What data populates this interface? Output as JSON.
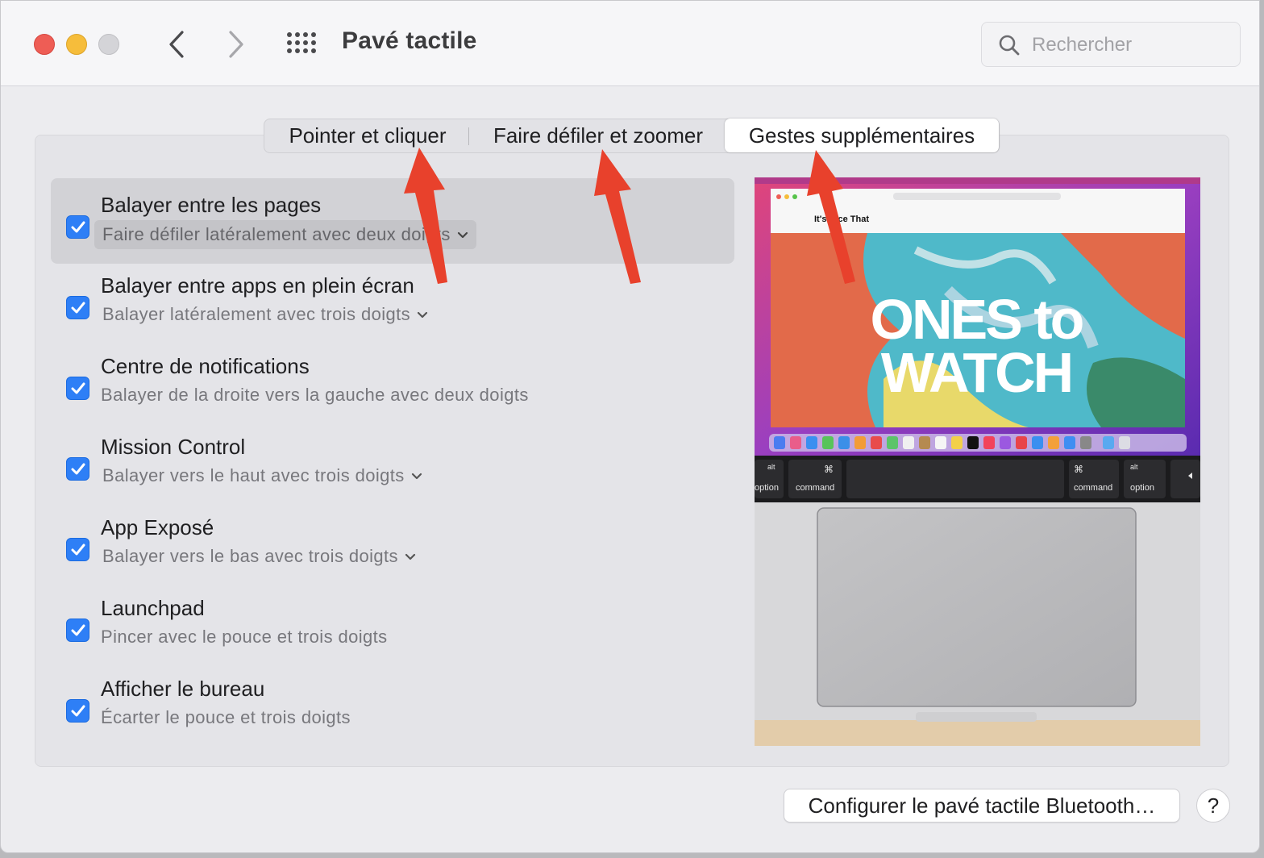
{
  "window": {
    "title": "Pavé tactile",
    "search_placeholder": "Rechercher"
  },
  "tabs": [
    {
      "label": "Pointer et cliquer",
      "selected": false
    },
    {
      "label": "Faire défiler et zoomer",
      "selected": false
    },
    {
      "label": "Gestes supplémentaires",
      "selected": true
    }
  ],
  "gestures": [
    {
      "title": "Balayer entre les pages",
      "subtitle": "Faire défiler latéralement avec deux doigts",
      "checked": true,
      "has_menu": true
    },
    {
      "title": "Balayer entre apps en plein écran",
      "subtitle": "Balayer latéralement avec trois doigts",
      "checked": true,
      "has_menu": true
    },
    {
      "title": "Centre de notifications",
      "subtitle": "Balayer de la droite vers la gauche avec deux doigts",
      "checked": true,
      "has_menu": false
    },
    {
      "title": "Mission Control",
      "subtitle": "Balayer vers le haut avec trois doigts",
      "checked": true,
      "has_menu": true
    },
    {
      "title": "App Exposé",
      "subtitle": "Balayer vers le bas avec trois doigts",
      "checked": true,
      "has_menu": true
    },
    {
      "title": "Launchpad",
      "subtitle": "Pincer avec le pouce et trois doigts",
      "checked": true,
      "has_menu": false
    },
    {
      "title": "Afficher le bureau",
      "subtitle": "Écarter le pouce et trois doigts",
      "checked": true,
      "has_menu": false
    }
  ],
  "preview": {
    "headline_line1": "ONES to",
    "headline_line2": "WATCH",
    "site_name": "It's Nice That",
    "keys": {
      "alt": "alt",
      "option": "option",
      "command": "command",
      "cmd_symbol": "⌘"
    }
  },
  "footer": {
    "bluetooth_button": "Configurer le pavé tactile Bluetooth…",
    "help_label": "?"
  },
  "colors": {
    "accent": "#2e7ff6",
    "annotation_arrow": "#e8412c"
  },
  "icons": {
    "back": "chevron-left-icon",
    "forward": "chevron-right-icon",
    "show_all": "grid-icon",
    "search": "magnifier-icon",
    "checkbox": "checkmark-icon",
    "menu": "chevron-down-icon"
  }
}
